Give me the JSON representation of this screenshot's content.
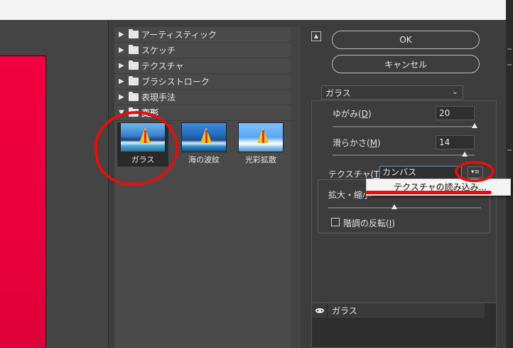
{
  "gallery": {
    "categories": [
      {
        "label": "アーティスティック",
        "open": false
      },
      {
        "label": "スケッチ",
        "open": false
      },
      {
        "label": "テクスチャ",
        "open": false
      },
      {
        "label": "ブラシストローク",
        "open": false
      },
      {
        "label": "表現手法",
        "open": false
      },
      {
        "label": "変形",
        "open": true
      }
    ],
    "thumbnails": [
      {
        "label": "ガラス",
        "selected": true
      },
      {
        "label": "海の波紋",
        "selected": false
      },
      {
        "label": "光彩拡散",
        "selected": false
      }
    ]
  },
  "buttons": {
    "ok": "OK",
    "cancel": "キャンセル"
  },
  "filter": {
    "selected": "ガラス"
  },
  "params": {
    "distortion": {
      "label": "ゆがみ(D)",
      "label_text": "ゆがみ(",
      "key": "D",
      "label_end": ")",
      "value": "20",
      "slider_fraction": 1.0
    },
    "smoothness": {
      "label": "滑らかさ(M)",
      "label_text": "滑らかさ(",
      "key": "M",
      "label_end": ")",
      "value": "14",
      "slider_fraction": 0.93
    },
    "texture": {
      "label": "テクスチャ(T) :",
      "label_text": "テクスチャ(",
      "key": "T",
      "label_end": ") :",
      "value": "カンバス"
    },
    "scaling": {
      "label": "拡大・縮小",
      "slider_fraction": 0.42
    },
    "invert": {
      "label": "階調の反転(I)",
      "label_text": "階調の反転(",
      "key": "I",
      "label_end": ")",
      "checked": false
    }
  },
  "popup_menu": {
    "item": "テクスチャの読み込み..."
  },
  "layers": [
    {
      "name": "ガラス",
      "visible": true
    }
  ],
  "icons": {
    "collapse": "collapse-icon",
    "eye": "eye-icon",
    "menu": "texture-menu-icon",
    "folder": "folder-icon"
  },
  "colors": {
    "canvas": "#f20040",
    "annotation": "#e01010",
    "panel": "#3d3d3d"
  }
}
